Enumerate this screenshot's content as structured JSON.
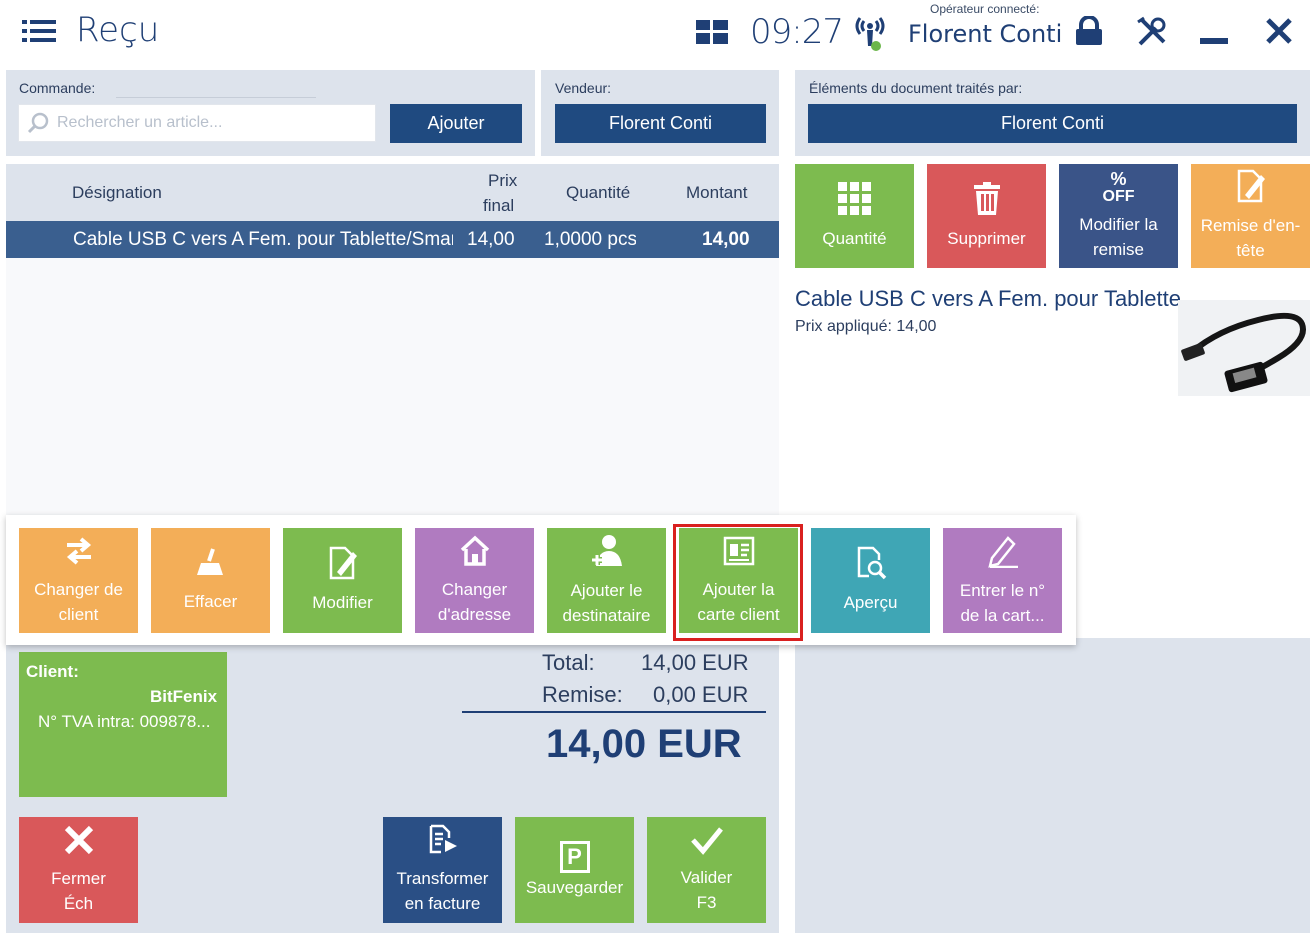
{
  "header": {
    "title": "Reçu",
    "time": "09:27",
    "operator_label": "Opérateur connecté:",
    "operator_name": "Florent Conti"
  },
  "order": {
    "command_label": "Commande:",
    "search_placeholder": "Rechercher un article...",
    "add_label": "Ajouter",
    "seller_label": "Vendeur:",
    "seller_name": "Florent Conti"
  },
  "processed": {
    "label": "Éléments du document traités par:",
    "name": "Florent Conti"
  },
  "table": {
    "col_designation": "Désignation",
    "col_price_1": "Prix",
    "col_price_2": "final",
    "col_qty": "Quantité",
    "col_amount": "Montant",
    "rows": [
      {
        "designation": "Cable USB C vers A Fem. pour Tablette/Smartphone",
        "price": "14,00",
        "qty": "1,0000 pcs",
        "amount": "14,00"
      }
    ]
  },
  "item_actions": {
    "quantity": "Quantité",
    "delete": "Supprimer",
    "discount_icon_1": "%",
    "discount_icon_2": "OFF",
    "discount": "Modifier la remise",
    "header_discount": "Remise d'en-tête"
  },
  "item_detail": {
    "name": "Cable USB C vers A Fem. pour Tablette/Smartphone",
    "price_label": "Prix appliqué: 14,00"
  },
  "doc_actions": {
    "change_client": "Changer de client",
    "clear": "Effacer",
    "edit": "Modifier",
    "change_address": "Changer d'adresse",
    "add_recipient": "Ajouter le destinataire",
    "add_card": "Ajouter la carte client",
    "preview": "Aperçu",
    "enter_card": "Entrer le n° de la cart..."
  },
  "client": {
    "label": "Client:",
    "name": "BitFenix",
    "vat": "N° TVA intra: 009878..."
  },
  "totals": {
    "total_label": "Total:",
    "total_value": "14,00 EUR",
    "discount_label": "Remise:",
    "discount_value": "0,00 EUR",
    "grand_total": "14,00 EUR"
  },
  "bottom": {
    "close_1": "Fermer",
    "close_2": "Éch",
    "invoice": "Transformer en facture",
    "save": "Sauvegarder",
    "validate_1": "Valider",
    "validate_2": "F3",
    "save_icon": "P"
  }
}
